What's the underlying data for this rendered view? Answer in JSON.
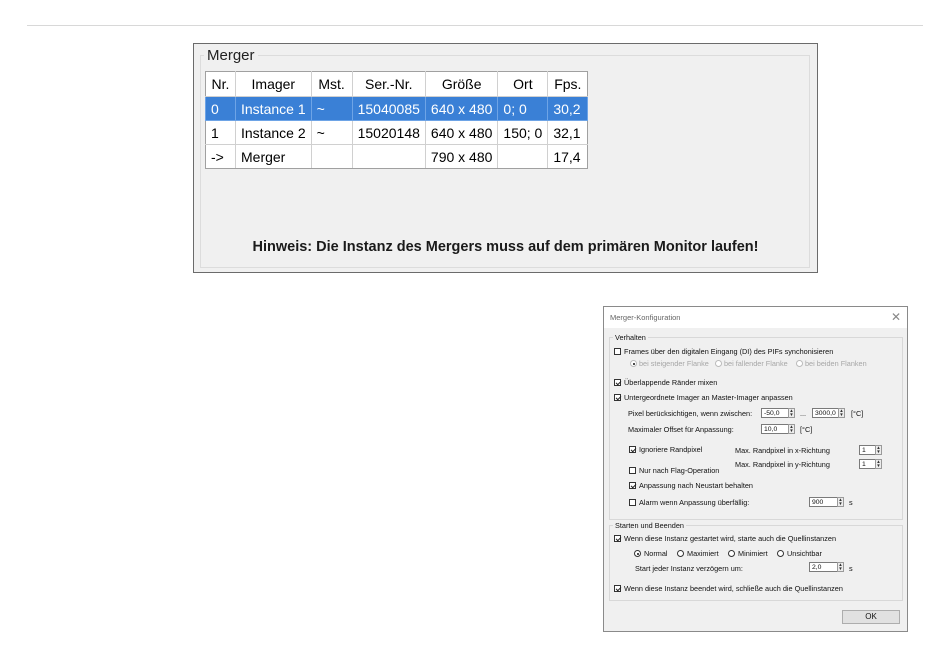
{
  "merger_panel": {
    "group_title": "Merger",
    "columns": [
      "Nr.",
      "Imager",
      "Mst.",
      "Ser.-Nr.",
      "Größe",
      "Ort",
      "Fps."
    ],
    "rows": [
      [
        "0",
        "Instance 1",
        "~",
        "15040085",
        "640 x 480",
        "0; 0",
        "30,2"
      ],
      [
        "1",
        "Instance 2",
        "~",
        "15020148",
        "640 x 480",
        "150; 0",
        "32,1"
      ],
      [
        "->",
        "Merger",
        "",
        "",
        "790 x 480",
        "",
        "17,4"
      ]
    ],
    "selected_row": 0,
    "hint": "Hinweis: Die Instanz des Mergers muss auf dem primären Monitor laufen!"
  },
  "dialog": {
    "title": "Merger-Konfiguration",
    "close_glyph": "✕",
    "behavior": {
      "legend": "Verhalten",
      "sync_frames": {
        "label": "Frames über den digitalen Eingang (DI) des PIFs synchonisieren",
        "checked": false
      },
      "edge_options": [
        "bei steigender Flanke",
        "bei fallender Flanke",
        "bei beiden Flanken"
      ],
      "edge_selected": 0,
      "mix_edges": {
        "label": "Überlappende Ränder mixen",
        "checked": true
      },
      "adapt_subordinate": {
        "label": "Untergeordnete Imager an Master-Imager anpassen",
        "checked": true
      },
      "pixel_range_label": "Pixel berücksichtigen, wenn zwischen:",
      "pixel_min": "-50,0",
      "range_sep": "...",
      "pixel_max": "3000,0",
      "unit_celsius": "[°C]",
      "max_offset_label": "Maximaler Offset für Anpassung:",
      "max_offset": "10,0",
      "ignore_border": {
        "label": "Ignoriere Randpixel",
        "checked": true
      },
      "max_border_x_label": "Max. Randpixel in x-Richtung",
      "max_border_x": "1",
      "max_border_y_label": "Max. Randpixel in y-Richtung",
      "max_border_y": "1",
      "flag_only": {
        "label": "Nur nach Flag-Operation",
        "checked": false
      },
      "keep_after_restart": {
        "label": "Anpassung nach Neustart behalten",
        "checked": true
      },
      "alarm_overdue": {
        "label": "Alarm wenn Anpassung überfällig:",
        "checked": false
      },
      "alarm_value": "900",
      "unit_s": "s"
    },
    "startstop": {
      "legend": "Starten und Beenden",
      "start_sources": {
        "label": "Wenn diese Instanz gestartet wird, starte auch die Quellinstanzen",
        "checked": true
      },
      "window_modes": [
        "Normal",
        "Maximiert",
        "Minimiert",
        "Unsichtbar"
      ],
      "window_mode_selected": 0,
      "delay_label": "Start jeder Instanz verzögern um:",
      "delay_value": "2,0",
      "unit_s": "s",
      "close_sources": {
        "label": "Wenn diese Instanz beendet wird, schließe auch die Quellinstanzen",
        "checked": true
      }
    },
    "ok_label": "OK"
  },
  "colors": {
    "selection": "#3a80d6",
    "dialog_bg": "#f0f0f0"
  }
}
